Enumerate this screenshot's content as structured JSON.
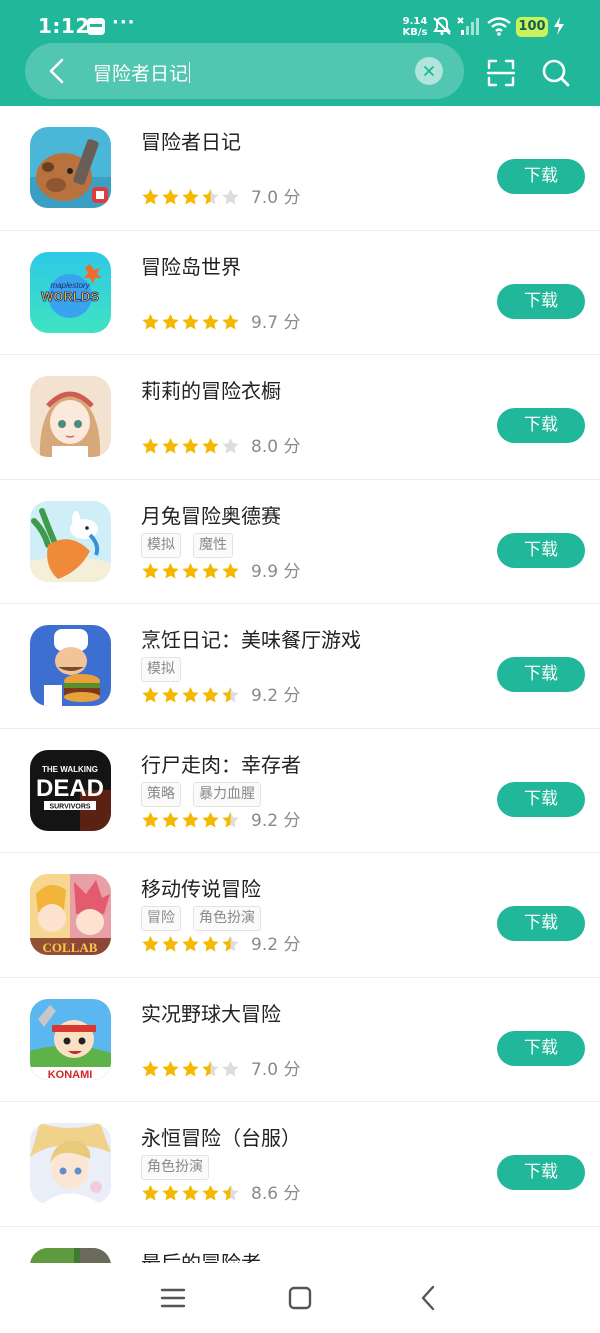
{
  "status_bar": {
    "time": "1:12",
    "dots": "···",
    "net_speed_value": "9.14",
    "net_speed_unit": "KB/s",
    "battery": "100"
  },
  "search": {
    "query": "冒险者日记",
    "clear_symbol": "×"
  },
  "colors": {
    "accent": "#21b79a",
    "star": "#f5b800",
    "star_empty": "#dddddd"
  },
  "download_label": "下载",
  "apps": [
    {
      "name": "冒险者日记",
      "tags": [],
      "score": "7.0 分",
      "rating": 3.5
    },
    {
      "name": "冒险岛世界",
      "tags": [],
      "score": "9.7 分",
      "rating": 5
    },
    {
      "name": "莉莉的冒险衣橱",
      "tags": [],
      "score": "8.0 分",
      "rating": 4
    },
    {
      "name": "月兔冒险奥德赛",
      "tags": [
        "模拟",
        "魔性"
      ],
      "score": "9.9 分",
      "rating": 5
    },
    {
      "name": "烹饪日记：美味餐厅游戏",
      "tags": [
        "模拟"
      ],
      "score": "9.2 分",
      "rating": 4.5
    },
    {
      "name": "行尸走肉：幸存者",
      "tags": [
        "策略",
        "暴力血腥"
      ],
      "score": "9.2 分",
      "rating": 4.5
    },
    {
      "name": "移动传说冒险",
      "tags": [
        "冒险",
        "角色扮演"
      ],
      "score": "9.2 分",
      "rating": 4.5
    },
    {
      "name": "实况野球大冒险",
      "tags": [],
      "score": "7.0 分",
      "rating": 3.5
    },
    {
      "name": "永恒冒险（台服）",
      "tags": [
        "角色扮演"
      ],
      "score": "8.6 分",
      "rating": 4.5
    },
    {
      "name": "最后的冒险者",
      "tags": [],
      "score": "",
      "rating": 0
    }
  ],
  "app_icon_text": {
    "maplestory_small": "maplestory",
    "maplestory_big": "WORLDS",
    "walking_dead_top": "THE WALKING",
    "walking_dead_big": "DEAD",
    "walking_dead_bottom": "SURVIVORS",
    "collab": "COLLAB",
    "konami": "KONAMI"
  },
  "nav": [
    "menu-icon",
    "home-icon",
    "back-icon"
  ]
}
